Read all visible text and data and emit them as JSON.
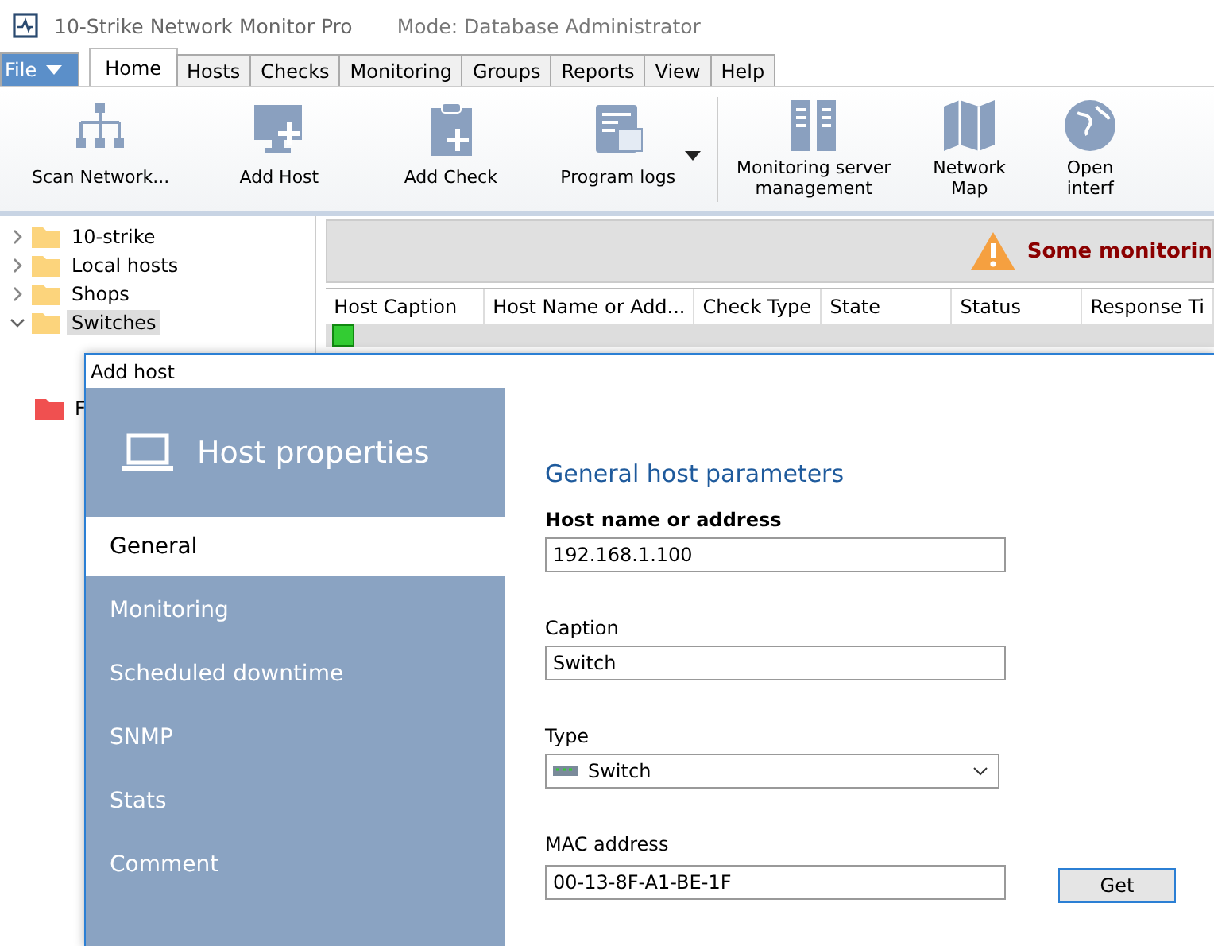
{
  "window": {
    "title": "10-Strike Network Monitor Pro",
    "mode": "Mode: Database Administrator"
  },
  "menu_tabs": [
    {
      "label": "File",
      "kind": "menu",
      "selected": false
    },
    {
      "label": "Home",
      "kind": "tab",
      "selected": true
    },
    {
      "label": "Hosts",
      "kind": "tab",
      "selected": false
    },
    {
      "label": "Checks",
      "kind": "tab",
      "selected": false
    },
    {
      "label": "Monitoring",
      "kind": "tab",
      "selected": false
    },
    {
      "label": "Groups",
      "kind": "tab",
      "selected": false
    },
    {
      "label": "Reports",
      "kind": "tab",
      "selected": false
    },
    {
      "label": "View",
      "kind": "tab",
      "selected": false
    },
    {
      "label": "Help",
      "kind": "tab",
      "selected": false
    }
  ],
  "ribbon": {
    "groups": [
      [
        {
          "label": "Scan Network...",
          "dropdown": false
        },
        {
          "label": "Add Host",
          "dropdown": false
        },
        {
          "label": "Add Check",
          "dropdown": false
        },
        {
          "label": "Program logs",
          "dropdown": true
        }
      ],
      [
        {
          "label": "Monitoring server management"
        },
        {
          "label": "Network Map"
        },
        {
          "label": "Open interf"
        }
      ]
    ]
  },
  "tree": [
    {
      "label": "10-strike",
      "expanded": false,
      "selected": false,
      "color": "#fcd47c"
    },
    {
      "label": "Local hosts",
      "expanded": false,
      "selected": false,
      "color": "#fcd47c"
    },
    {
      "label": "Shops",
      "expanded": false,
      "selected": false,
      "color": "#fcd47c"
    },
    {
      "label": "Switches",
      "expanded": true,
      "selected": true,
      "color": "#fcd47c"
    },
    {
      "label": "F",
      "leaf": true,
      "selected": false,
      "color": "#f05050"
    }
  ],
  "banner": {
    "text": "Some monitorin"
  },
  "table": {
    "columns": [
      "Host Caption",
      "Host Name or Add...",
      "Check Type",
      "State",
      "Status",
      "Response Ti"
    ]
  },
  "dialog": {
    "title": "Add host",
    "header": "Host properties",
    "nav": [
      {
        "label": "General",
        "selected": true
      },
      {
        "label": "Monitoring",
        "selected": false
      },
      {
        "label": "Scheduled downtime",
        "selected": false
      },
      {
        "label": "SNMP",
        "selected": false
      },
      {
        "label": "Stats",
        "selected": false
      },
      {
        "label": "Comment",
        "selected": false
      }
    ],
    "section_title": "General host parameters",
    "fields": [
      {
        "label": "Host name or address",
        "kind": "text",
        "value": "192.168.1.100"
      },
      {
        "label": "Caption",
        "kind": "text",
        "value": "Switch"
      },
      {
        "label": "Type",
        "kind": "select",
        "value": "Switch"
      },
      {
        "label": "MAC address",
        "kind": "text",
        "value": "00-13-8F-A1-BE-1F",
        "button": "Get"
      }
    ]
  }
}
